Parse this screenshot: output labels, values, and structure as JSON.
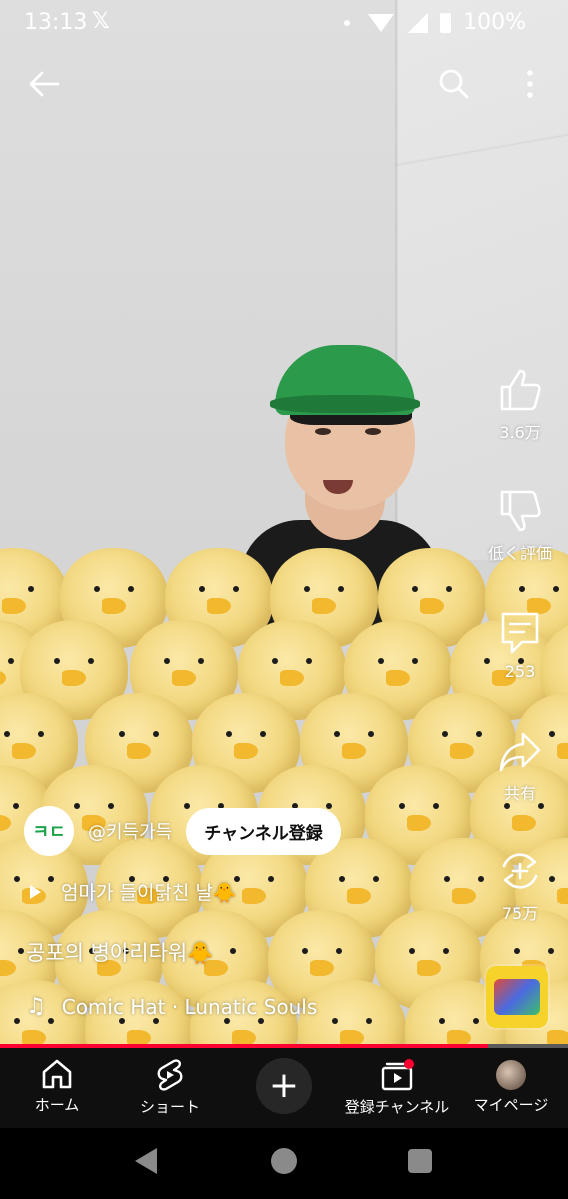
{
  "status_bar": {
    "time": "13:13",
    "x_logo": "𝕏",
    "battery": "100%"
  },
  "top_bar": {
    "back_icon": "arrow-left-icon",
    "search_icon": "search-icon",
    "more_icon": "more-vert-icon"
  },
  "rail": {
    "like_count": "3.6万",
    "dislike_label": "低く評価",
    "comment_count": "253",
    "share_label": "共有",
    "remix_count": "75万"
  },
  "channel": {
    "avatar_text": "ㅋㄷ",
    "handle": "@키득가득",
    "subscribe_label": "チャンネル登録"
  },
  "playlist": {
    "label": "엄마가 들이닭친 날🐥"
  },
  "video": {
    "title": "공포의 병아리타워🐥"
  },
  "music": {
    "track": "Comic Hat · Lunatic Souls"
  },
  "progress": {
    "fraction": 0.86,
    "color": "#ff0033"
  },
  "nav": {
    "home": "ホーム",
    "shorts": "ショート",
    "subscriptions": "登録チャンネル",
    "mypage": "マイページ"
  },
  "colors": {
    "accent": "#ff0033",
    "nav_bg": "#0f0f0f",
    "cap_green": "#2b9a4b",
    "chick_yellow": "#f1d57a"
  }
}
